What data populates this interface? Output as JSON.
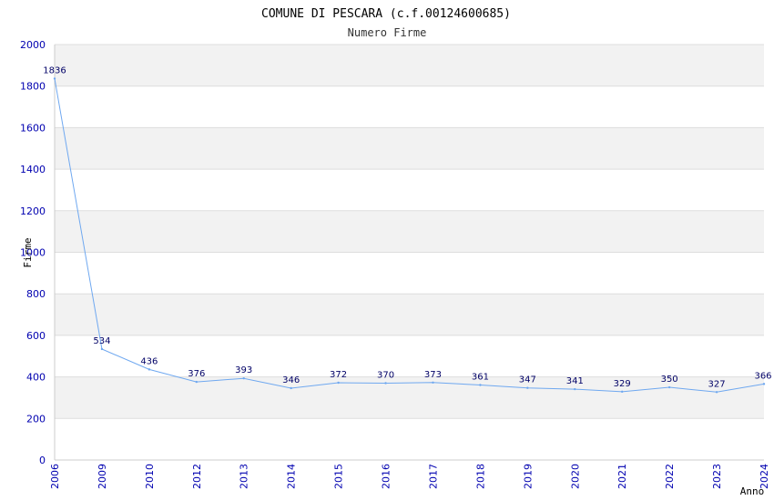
{
  "chart_data": {
    "type": "line",
    "title": "COMUNE DI PESCARA (c.f.00124600685)",
    "subtitle": "Numero Firme",
    "xlabel": "Anno",
    "ylabel": "Firme",
    "categories": [
      "2006",
      "2009",
      "2010",
      "2012",
      "2013",
      "2014",
      "2015",
      "2016",
      "2017",
      "2018",
      "2019",
      "2020",
      "2021",
      "2022",
      "2023",
      "2024"
    ],
    "series": [
      {
        "values": [
          1836,
          534,
          436,
          376,
          393,
          346,
          372,
          370,
          373,
          361,
          347,
          341,
          329,
          350,
          327,
          366
        ]
      }
    ],
    "ylim": [
      0,
      2000
    ],
    "yticks": [
      0,
      200,
      400,
      600,
      800,
      1000,
      1200,
      1400,
      1600,
      1800,
      2000
    ],
    "grid": true,
    "legend": "none",
    "colors": {
      "line": "#6fa8f0",
      "band": "#f2f2f2",
      "gridline": "#dddddd",
      "tick_text": "#0000b0",
      "label_text": "#000066"
    }
  }
}
